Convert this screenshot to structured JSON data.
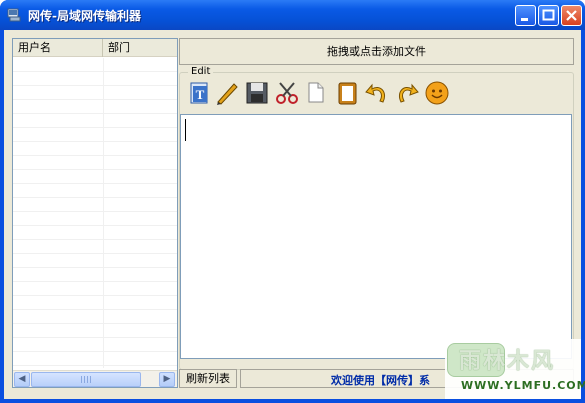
{
  "window": {
    "title": "网传-局域网传输利器",
    "accent": "#0a4fe0"
  },
  "user_list": {
    "columns": [
      "用户名",
      "部门"
    ]
  },
  "drop_zone": {
    "label": "拖拽或点击添加文件"
  },
  "edit": {
    "group_label": "Edit",
    "toolbar": [
      "text-format-icon",
      "pen-icon",
      "save-icon",
      "cut-icon",
      "copy-icon",
      "paste-icon",
      "undo-icon",
      "redo-icon",
      "emoticon-icon"
    ]
  },
  "statusbar": {
    "refresh_label": "刷新列表",
    "message": "欢迎使用【网传】系"
  },
  "watermark": {
    "text": "雨林木风",
    "url": "WWW.YLMFU.COM"
  }
}
